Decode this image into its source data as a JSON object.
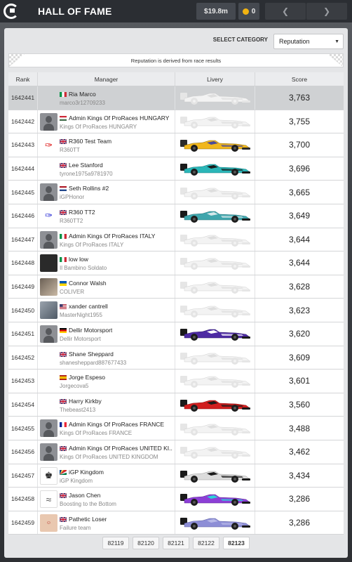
{
  "header": {
    "title": "HALL OF FAME",
    "cash": "$19.8m",
    "tokens": "0"
  },
  "filter": {
    "label": "SELECT CATEGORY",
    "selected": "Reputation"
  },
  "info": "Reputation is derived from race results",
  "columns": {
    "rank": "Rank",
    "manager": "Manager",
    "livery": "Livery",
    "score": "Score"
  },
  "rows": [
    {
      "rank": "1642441",
      "name": "Ria Marco",
      "sub": "marco3r12709233",
      "score": "3,763",
      "flag": "it",
      "avatar": "none",
      "livery": "white",
      "highlight": true
    },
    {
      "rank": "1642442",
      "name": "Admin Kings Of ProRaces HUNGARY",
      "sub": "Kings Of ProRaces HUNGARY",
      "score": "3,755",
      "flag": "hu",
      "avatar": "gray",
      "livery": "white"
    },
    {
      "rank": "1642443",
      "name": "R360 Test Team",
      "sub": "R360TT",
      "score": "3,700",
      "flag": "gb",
      "avatar": "logo-red",
      "livery": "yellow"
    },
    {
      "rank": "1642444",
      "name": "Lee Stanford",
      "sub": "tyrone1975a9781970",
      "score": "3,696",
      "flag": "gb",
      "avatar": "none",
      "livery": "teal"
    },
    {
      "rank": "1642445",
      "name": "Seth Rollins #2",
      "sub": "iGPHonor",
      "score": "3,665",
      "flag": "nl",
      "avatar": "gray",
      "livery": "white"
    },
    {
      "rank": "1642446",
      "name": "R360 TT2",
      "sub": "R360TT2",
      "score": "3,649",
      "flag": "gb",
      "avatar": "logo-blue",
      "livery": "teal2"
    },
    {
      "rank": "1642447",
      "name": "Admin Kings Of ProRaces ITALY",
      "sub": "Kings Of ProRaces ITALY",
      "score": "3,644",
      "flag": "it",
      "avatar": "gray",
      "livery": "white"
    },
    {
      "rank": "1642448",
      "name": "low low",
      "sub": "Il Bambino Soldato",
      "score": "3,644",
      "flag": "it",
      "avatar": "dark",
      "livery": "white"
    },
    {
      "rank": "1642449",
      "name": "Connor Walsh",
      "sub": "COLIVER",
      "score": "3,628",
      "flag": "ua",
      "avatar": "photo",
      "livery": "white"
    },
    {
      "rank": "1642450",
      "name": "xander cantrell",
      "sub": "MasterNight1955",
      "score": "3,623",
      "flag": "us",
      "avatar": "photo2",
      "livery": "white"
    },
    {
      "rank": "1642451",
      "name": "Dellir Motorsport",
      "sub": "Dellir Motorsport",
      "score": "3,620",
      "flag": "de",
      "avatar": "gray",
      "livery": "purple"
    },
    {
      "rank": "1642452",
      "name": "Shane Sheppard",
      "sub": "shanesheppard887677433",
      "score": "3,609",
      "flag": "gb",
      "avatar": "none",
      "livery": "white"
    },
    {
      "rank": "1642453",
      "name": "Jorge Espeso",
      "sub": "Jorgecova5",
      "score": "3,601",
      "flag": "es",
      "avatar": "none",
      "livery": "white"
    },
    {
      "rank": "1642454",
      "name": "Harry Kirkby",
      "sub": "Thebeast2413",
      "score": "3,560",
      "flag": "gb",
      "avatar": "none",
      "livery": "red"
    },
    {
      "rank": "1642455",
      "name": "Admin Kings Of ProRaces FRANCE",
      "sub": "Kings Of ProRaces FRANCE",
      "score": "3,488",
      "flag": "fr",
      "avatar": "gray",
      "livery": "white"
    },
    {
      "rank": "1642456",
      "name": "Admin Kings Of ProRaces UNITED KI...",
      "sub": "Kings Of ProRaces UNITED KINGDOM",
      "score": "3,462",
      "flag": "gb",
      "avatar": "gray",
      "livery": "white"
    },
    {
      "rank": "1642457",
      "name": "iGP Kingdom",
      "sub": "iGP Kingdom",
      "score": "3,434",
      "flag": "sc",
      "avatar": "white",
      "livery": "silver"
    },
    {
      "rank": "1642458",
      "name": "Jason Chen",
      "sub": "Boosting to the Bottom",
      "score": "3,286",
      "flag": "gb",
      "avatar": "tornado",
      "livery": "magenta"
    },
    {
      "rank": "1642459",
      "name": "Pathetic Loser",
      "sub": "Failure team",
      "score": "3,286",
      "flag": "gb",
      "avatar": "loser",
      "livery": "lavender"
    }
  ],
  "pagination": [
    "82119",
    "82120",
    "82121",
    "82122",
    "82123"
  ],
  "active_page": "82123"
}
